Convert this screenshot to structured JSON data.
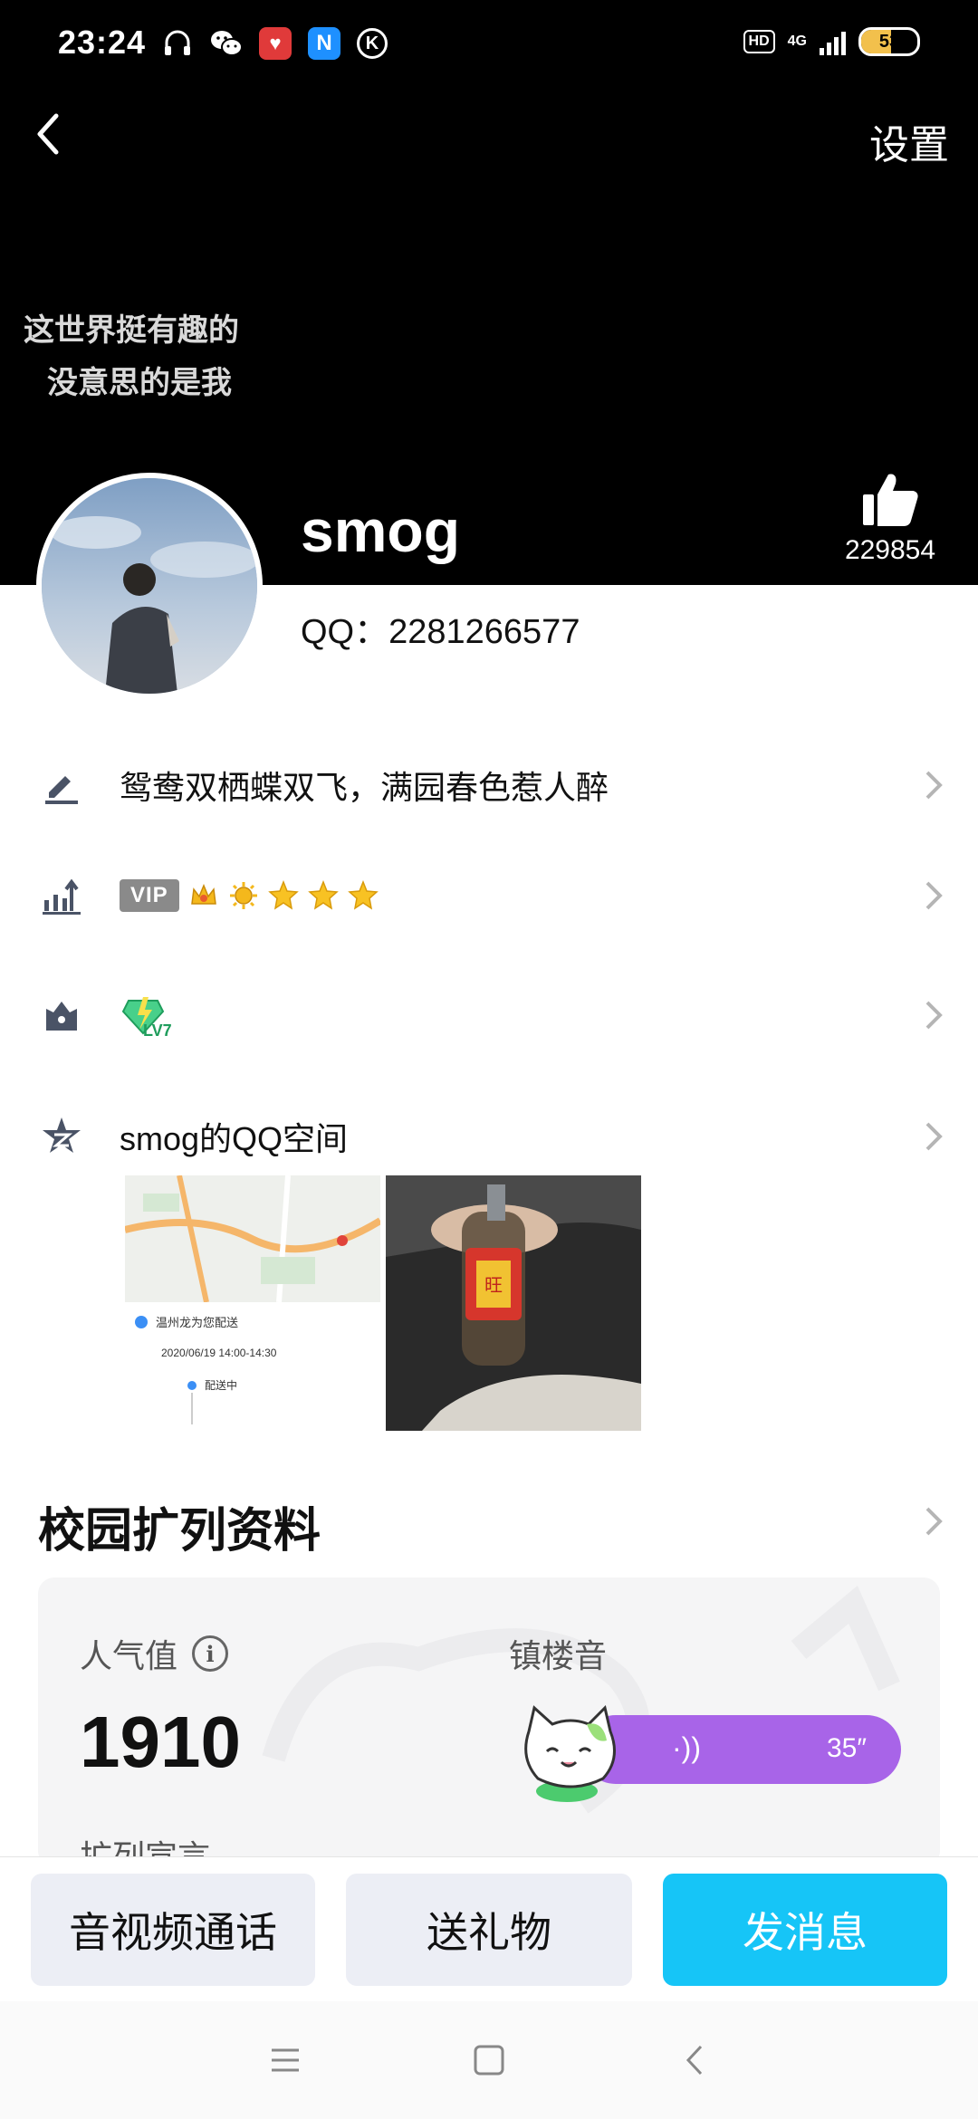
{
  "status_bar": {
    "time": "23:24",
    "network": "4G",
    "hd": "HD",
    "battery": "53",
    "battery_level": 0.53,
    "app_icons": [
      "headset-icon",
      "wechat-icon",
      "red-app-icon",
      "n-app-icon",
      "k-app-icon"
    ]
  },
  "nav": {
    "back_icon": "back-arrow-icon",
    "settings_label": "设置"
  },
  "profile": {
    "signature_line1": "这世界挺有趣的",
    "signature_line2": "没意思的是我",
    "username": "smog",
    "qq_line": "QQ：2281266577",
    "like_count": "229854"
  },
  "rows": {
    "status_text": "鸳鸯双栖蝶双飞，满园春色惹人醉",
    "vip_label": "VIP",
    "level_medals": [
      "crown-icon",
      "sun-icon",
      "star-icon",
      "star-icon",
      "star-icon"
    ],
    "badge_label": "LV7",
    "qzone_label": "smog的QQ空间"
  },
  "photos": [
    {
      "name": "map-screenshot",
      "timestamp": "2020/06/19 14:00-14:30",
      "status": "配送中"
    },
    {
      "name": "bottle-photo"
    }
  ],
  "campus": {
    "title": "校园扩列资料",
    "popularity_label": "人气值",
    "popularity_value": "1910",
    "voice_label": "镇楼音",
    "voice_duration": "35″",
    "partial_label": "扩列宣言"
  },
  "actions": {
    "call": "音视频通话",
    "gift": "送礼物",
    "message": "发消息"
  },
  "colors": {
    "header_bg": "#000000",
    "message_button": "#16c5f7",
    "voice_bar": "#a864e8",
    "secondary_button": "#eceef5"
  }
}
